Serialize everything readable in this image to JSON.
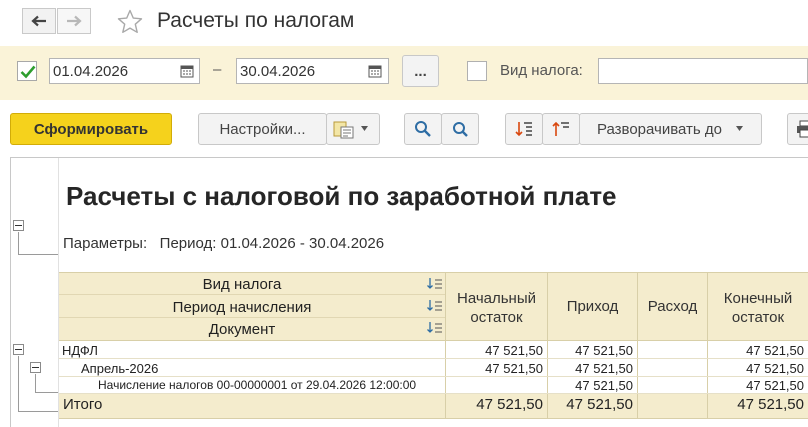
{
  "window": {
    "title": "Расчеты по налогам"
  },
  "filter": {
    "period_checked": true,
    "date_from": "01.04.2026",
    "date_sep": "–",
    "date_to": "30.04.2026",
    "more_label": "...",
    "tax_type_label": "Вид налога:",
    "tax_type_value": ""
  },
  "toolbar": {
    "generate_label": "Сформировать",
    "settings_label": "Настройки...",
    "expand_label": "Разворачивать до"
  },
  "report": {
    "title": "Расчеты с налоговой по заработной плате",
    "params_label": "Параметры:",
    "params_value": "Период: 01.04.2026 - 30.04.2026",
    "headers": {
      "tax_type": "Вид налога",
      "period": "Период начисления",
      "document": "Документ",
      "opening": [
        "Начальный",
        "остаток"
      ],
      "income": "Приход",
      "expense": "Расход",
      "closing": [
        "Конечный",
        "остаток"
      ]
    },
    "rows": [
      {
        "name": "НДФЛ",
        "opening": "47 521,50",
        "income": "47 521,50",
        "expense": "",
        "closing": "47 521,50"
      },
      {
        "name": "Апрель-2026",
        "opening": "47 521,50",
        "income": "47 521,50",
        "expense": "",
        "closing": "47 521,50"
      },
      {
        "name": "Начисление налогов 00-00000001 от 29.04.2026 12:00:00",
        "opening": "",
        "income": "47 521,50",
        "expense": "",
        "closing": "47 521,50"
      }
    ],
    "total": {
      "label": "Итого",
      "opening": "47 521,50",
      "income": "47 521,50",
      "expense": "",
      "closing": "47 521,50"
    }
  }
}
